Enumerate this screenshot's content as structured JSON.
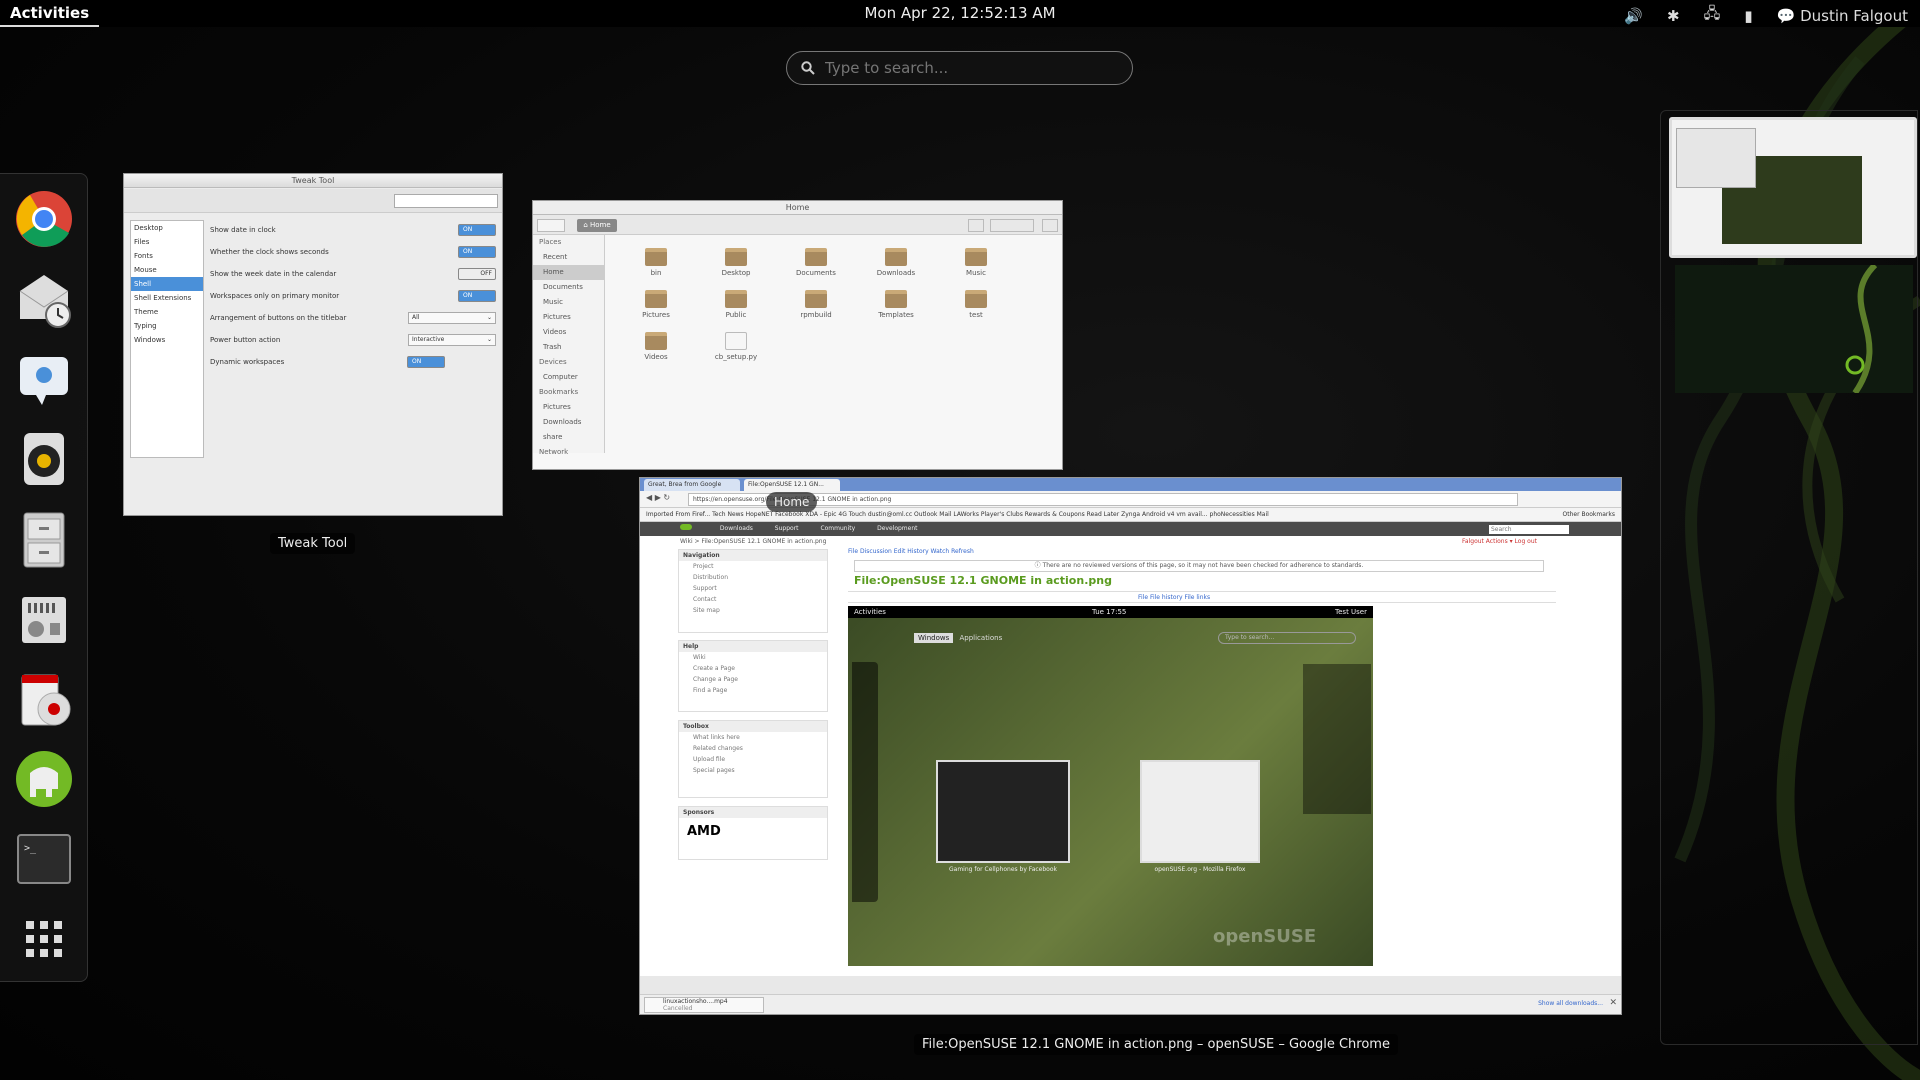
{
  "topbar": {
    "activities": "Activities",
    "clock": "Mon Apr 22, 12:52:13 AM",
    "user": "Dustin Falgout"
  },
  "search": {
    "placeholder": "Type to search..."
  },
  "dash": {
    "apps": [
      "chrome-icon",
      "mail-clock-icon",
      "chat-icon",
      "speaker-icon",
      "file-cabinet-icon",
      "settings-icon",
      "disc-icon",
      "elephant-icon",
      "terminal-icon",
      "app-grid-icon"
    ]
  },
  "tweak_tool": {
    "title": "Tweak Tool",
    "caption": "Tweak Tool",
    "sidebar": [
      "Desktop",
      "Files",
      "Fonts",
      "Mouse",
      "Shell",
      "Shell Extensions",
      "Theme",
      "Typing",
      "Windows"
    ],
    "rows": [
      {
        "label": "Show date in clock",
        "control": "ON"
      },
      {
        "label": "Whether the clock shows seconds",
        "control": "ON"
      },
      {
        "label": "Show the week date in the calendar",
        "control": "OFF"
      },
      {
        "label": "Workspaces only on primary monitor",
        "control": "ON"
      },
      {
        "label": "Arrangement of buttons on the titlebar",
        "control": "All"
      },
      {
        "label": "Power button action",
        "control": "Interactive"
      },
      {
        "label": "Dynamic workspaces",
        "control": "ON"
      }
    ]
  },
  "files": {
    "title": "Home",
    "path_button": "Home",
    "sidebar": [
      {
        "label": "Places",
        "h": true
      },
      {
        "label": "Recent"
      },
      {
        "label": "Home",
        "sel": true
      },
      {
        "label": "Documents"
      },
      {
        "label": "Music"
      },
      {
        "label": "Pictures"
      },
      {
        "label": "Videos"
      },
      {
        "label": "Trash"
      },
      {
        "label": "Devices",
        "h": true
      },
      {
        "label": "Computer"
      },
      {
        "label": "Bookmarks",
        "h": true
      },
      {
        "label": "Pictures"
      },
      {
        "label": "Downloads"
      },
      {
        "label": "share"
      },
      {
        "label": "Network",
        "h": true
      }
    ],
    "folders": [
      "bin",
      "Desktop",
      "Documents",
      "Downloads",
      "Music",
      "Pictures",
      "Public",
      "rpmbuild",
      "Templates",
      "test",
      "Videos",
      "cb_setup.py"
    ]
  },
  "chrome": {
    "caption": "File:OpenSUSE 12.1 GNOME in action.png – openSUSE – Google Chrome",
    "hover_label": "Home",
    "tabs": [
      "Great, Brea from Google",
      "File:OpenSUSE 12.1 GN..."
    ],
    "url": "https://en.opensuse.org/File:OpenSUSE 12.1 GNOME in action.png",
    "bookmarks": "Imported From Firef...   Tech News   HopeNET   Facebook   XDA - Epic 4G Touch   dustin@oml.cc   Outlook Mail   LAWorks   Player's Clubs   Rewards & Coupons   Read Later   Zynga   Android v4 vm avail...   phoNecessities Mail",
    "other_bookmarks": "Other Bookmarks",
    "nav": [
      "Downloads",
      "Support",
      "Community",
      "Development"
    ],
    "site_search": "Search",
    "breadcrumb": "Wiki > File:OpenSUSE 12.1 GNOME in action.png",
    "user_links": "Falgout   Actions ▾   Log out",
    "page_tabs": "File   Discussion   Edit   History   Watch   Refresh",
    "notice": "There are no reviewed versions of this page, so it may not have been checked for adherence to standards.",
    "heading": "File:OpenSUSE 12.1 GNOME in action.png",
    "file_tabs": "File     File history     File links",
    "panels": [
      {
        "title": "Navigation",
        "items": [
          "Project",
          "Distribution",
          "Support",
          "Contact",
          "Site map"
        ]
      },
      {
        "title": "Help",
        "items": [
          "Wiki",
          "Create a Page",
          "Change a Page",
          "Find a Page"
        ]
      },
      {
        "title": "Toolbox",
        "items": [
          "What links here",
          "Related changes",
          "Upload file",
          "Special pages"
        ]
      },
      {
        "title": "Sponsors",
        "items": [
          "AMD"
        ]
      }
    ],
    "shot": {
      "activities": "Activities",
      "time": "Tue 17:55",
      "user": "Test User",
      "windows": "Windows",
      "applications": "Applications",
      "search": "Type to search...",
      "cap1": "Gaming for Cellphones by Facebook",
      "cap2": "openSUSE.org - Mozilla Firefox",
      "logo": "openSUSE"
    },
    "download": "linuxactionsho....mp4",
    "download_status": "Cancelled",
    "show_downloads": "Show all downloads..."
  },
  "colors": {
    "accent": "#4a90d9",
    "opensuse_green": "#73ba25"
  }
}
